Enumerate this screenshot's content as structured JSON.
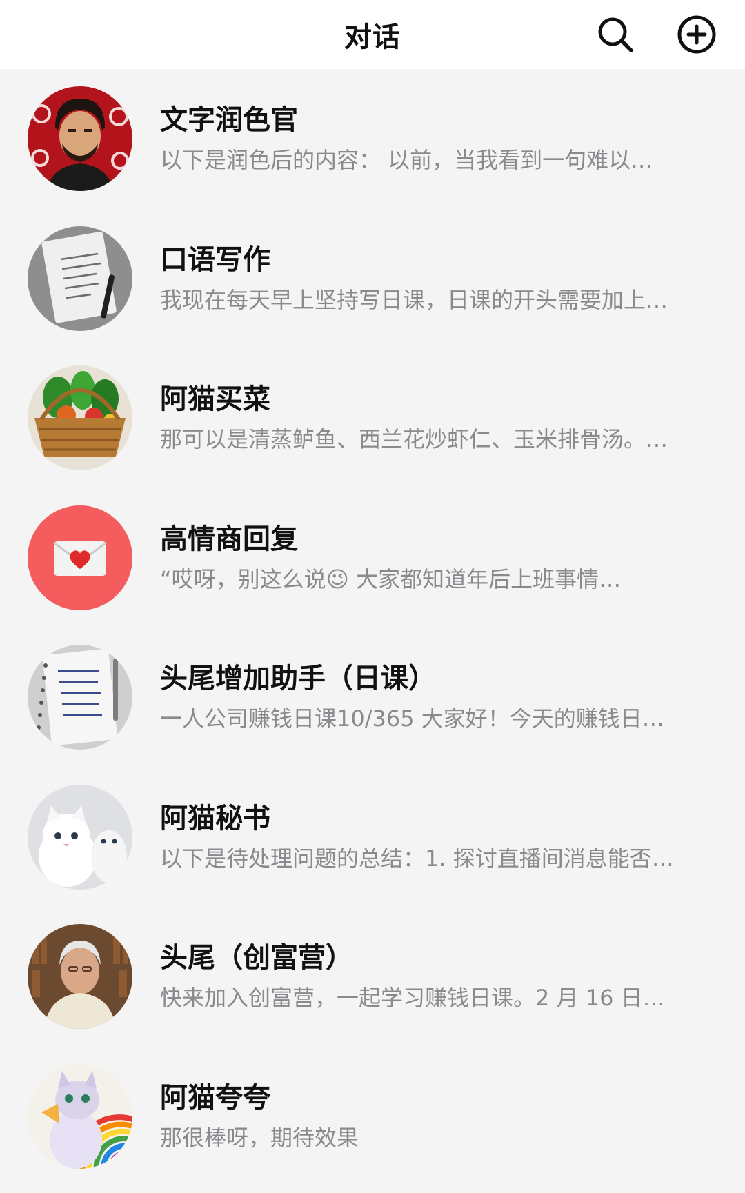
{
  "header": {
    "title": "对话",
    "search_icon": "search-icon",
    "add_icon": "plus-circle-icon"
  },
  "chats": [
    {
      "name": "文字润色官",
      "preview": "以下是润色后的内容： 以前，当我看到一句难以…",
      "avatar": "bearded-man-avatar"
    },
    {
      "name": "口语写作",
      "preview": "我现在每天早上坚持写日课，日课的开头需要加上…",
      "avatar": "notebook-avatar"
    },
    {
      "name": "阿猫买菜",
      "preview": "那可以是清蒸鲈鱼、西兰花炒虾仁、玉米排骨汤。…",
      "avatar": "vegetable-basket-avatar"
    },
    {
      "name": "高情商回复",
      "preview": "“哎呀，别这么说😉 大家都知道年后上班事情…",
      "avatar": "heart-envelope-avatar"
    },
    {
      "name": "头尾增加助手（日课）",
      "preview": "一人公司赚钱日课10/365 大家好！今天的赚钱日…",
      "avatar": "handwriting-notebook-avatar"
    },
    {
      "name": "阿猫秘书",
      "preview": "以下是待处理问题的总结：1. 探讨直播间消息能否…",
      "avatar": "white-kittens-avatar"
    },
    {
      "name": "头尾（创富营）",
      "preview": "快来加入创富营，一起学习赚钱日课。2 月 16 日…",
      "avatar": "elderly-man-avatar"
    },
    {
      "name": "阿猫夸夸",
      "preview": "那很棒呀，期待效果",
      "avatar": "rainbow-cat-avatar"
    }
  ],
  "colors": {
    "header_bg": "#ffffff",
    "list_bg": "#f4f4f5",
    "name_text": "#111111",
    "preview_text": "#8a8a8e",
    "envelope_avatar_bg": "#f45c5e"
  }
}
